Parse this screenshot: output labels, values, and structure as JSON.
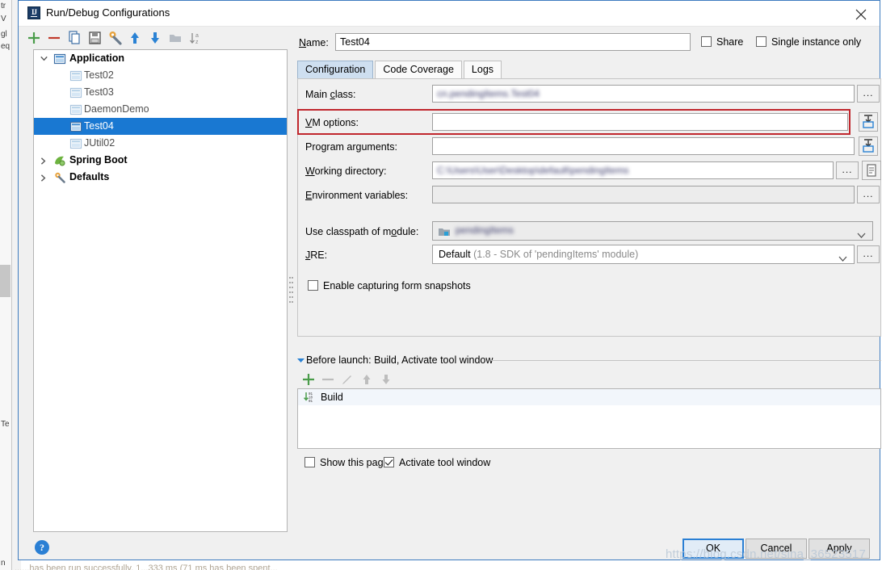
{
  "window": {
    "title": "Run/Debug Configurations",
    "app_icon": "intellij-idea-icon",
    "close_icon": "close-icon"
  },
  "toolbar": {
    "buttons": [
      {
        "name": "add-configuration-button",
        "icon": "plus-icon",
        "tooltip": "Add New Configuration"
      },
      {
        "name": "remove-configuration-button",
        "icon": "minus-icon",
        "tooltip": "Remove Configuration"
      },
      {
        "name": "copy-configuration-button",
        "icon": "copy-icon",
        "tooltip": "Copy Configuration"
      },
      {
        "name": "save-configuration-button",
        "icon": "save-icon",
        "tooltip": "Save Configuration"
      },
      {
        "name": "edit-templates-button",
        "icon": "wrench-icon",
        "tooltip": "Edit Templates"
      },
      {
        "name": "move-up-button",
        "icon": "arrow-up-icon",
        "tooltip": "Move Up"
      },
      {
        "name": "move-down-button",
        "icon": "arrow-down-icon",
        "tooltip": "Move Down"
      },
      {
        "name": "move-into-folder-button",
        "icon": "folder-icon",
        "tooltip": "Create New Folder"
      },
      {
        "name": "sort-configurations-button",
        "icon": "sort-alpha-icon",
        "tooltip": "Sort Configurations"
      }
    ]
  },
  "tree": {
    "items": [
      {
        "label": "Application",
        "icon": "application-icon",
        "level": 0,
        "expanded": true,
        "bold": true,
        "selected": false,
        "arrow": "chevron-down"
      },
      {
        "label": "Test02",
        "icon": "application-icon",
        "level": 1,
        "expanded": null,
        "bold": false,
        "selected": false,
        "arrow": ""
      },
      {
        "label": "Test03",
        "icon": "application-icon",
        "level": 1,
        "expanded": null,
        "bold": false,
        "selected": false,
        "arrow": ""
      },
      {
        "label": "DaemonDemo",
        "icon": "application-icon",
        "level": 1,
        "expanded": null,
        "bold": false,
        "selected": false,
        "arrow": ""
      },
      {
        "label": "Test04",
        "icon": "application-icon",
        "level": 1,
        "expanded": null,
        "bold": false,
        "selected": true,
        "arrow": ""
      },
      {
        "label": "JUtil02",
        "icon": "application-icon",
        "level": 1,
        "expanded": null,
        "bold": false,
        "selected": false,
        "arrow": ""
      },
      {
        "label": "Spring Boot",
        "icon": "spring-boot-icon",
        "level": 0,
        "expanded": false,
        "bold": true,
        "selected": false,
        "arrow": "chevron-right"
      },
      {
        "label": "Defaults",
        "icon": "wrench-icon",
        "level": 0,
        "expanded": false,
        "bold": true,
        "selected": false,
        "arrow": "chevron-right"
      }
    ]
  },
  "name_row": {
    "label": "Name:",
    "value": "Test04",
    "placeholder": "",
    "share_label": "Share",
    "share_checked": false,
    "single_instance_label": "Single instance only",
    "single_instance_checked": false
  },
  "tabs": [
    {
      "label": "Configuration",
      "active": true
    },
    {
      "label": "Code Coverage",
      "active": false
    },
    {
      "label": "Logs",
      "active": false
    }
  ],
  "form": {
    "main_class": {
      "label": "Main class:",
      "value": "cn.pendingItems.Test04",
      "redacted": true,
      "browse": "...",
      "browse_icon": "ellipsis-icon"
    },
    "vm_options": {
      "label": "VM options:",
      "value": "",
      "redacted": false,
      "browse_icon": "expand-editor-icon",
      "highlighted": true
    },
    "program_arguments": {
      "label": "Program arguments:",
      "value": "",
      "redacted": false,
      "browse_icon": "expand-editor-icon"
    },
    "working_directory": {
      "label": "Working directory:",
      "value": "C:\\Users\\User\\Desktop\\default\\pendingItems",
      "redacted": true,
      "browse": "...",
      "browse_icon": "ellipsis-icon",
      "macros_icon": "macros-icon"
    },
    "environment_variables": {
      "label": "Environment variables:",
      "value": "",
      "redacted": false,
      "browse": "...",
      "browse_icon": "ellipsis-icon",
      "disabled": true
    },
    "use_classpath_of_module": {
      "label": "Use classpath of module:",
      "value": "pendingItems",
      "redacted": true,
      "icon": "module-icon",
      "arrow_icon": "chevron-down-icon"
    },
    "jre": {
      "label": "JRE:",
      "value_strong": "Default",
      "value_muted": "(1.8 - SDK of 'pendingItems' module)",
      "browse": "...",
      "browse_icon": "ellipsis-icon",
      "arrow_icon": "chevron-down-icon"
    },
    "enable_capturing": {
      "label": "Enable capturing form snapshots",
      "checked": false
    }
  },
  "before_launch": {
    "header": "Before launch: Build, Activate tool window",
    "collapse_icon": "triangle-down-icon",
    "toolbar": [
      {
        "name": "before-launch-add-button",
        "icon": "plus-icon",
        "enabled": true
      },
      {
        "name": "before-launch-remove-button",
        "icon": "minus-icon",
        "enabled": false
      },
      {
        "name": "before-launch-edit-button",
        "icon": "pencil-icon",
        "enabled": false
      },
      {
        "name": "before-launch-up-button",
        "icon": "arrow-up-icon",
        "enabled": false
      },
      {
        "name": "before-launch-down-button",
        "icon": "arrow-down-icon",
        "enabled": false
      }
    ],
    "items": [
      {
        "label": "Build",
        "icon": "build-icon"
      }
    ],
    "show_this_page": {
      "label": "Show this page",
      "checked": false
    },
    "activate_tool_window": {
      "label": "Activate tool window",
      "checked": true
    }
  },
  "footer": {
    "help_icon": "help-icon",
    "ok": "OK",
    "cancel": "Cancel",
    "apply": "Apply"
  },
  "watermark": "https://blog.csdn.net/sina_36523517",
  "background": {
    "ghost_1": "tr",
    "ghost_2": "V",
    "ghost_3": "gl",
    "ghost_4": "eq",
    "ghost_5": "Te",
    "ghost_6": "n",
    "bottom_text": "......has been run successfully, 1...333 ms (71 ms has been spent...",
    "scrollbar_icon": "scrollbar-thumb"
  },
  "colors": {
    "accent": "#1978d2",
    "highlight_red": "#c0272d",
    "dialog_border": "#3d7bbf",
    "tab_active": "#cedff0",
    "add_green": "#4a9c4a",
    "remove_red": "#c0392b"
  }
}
